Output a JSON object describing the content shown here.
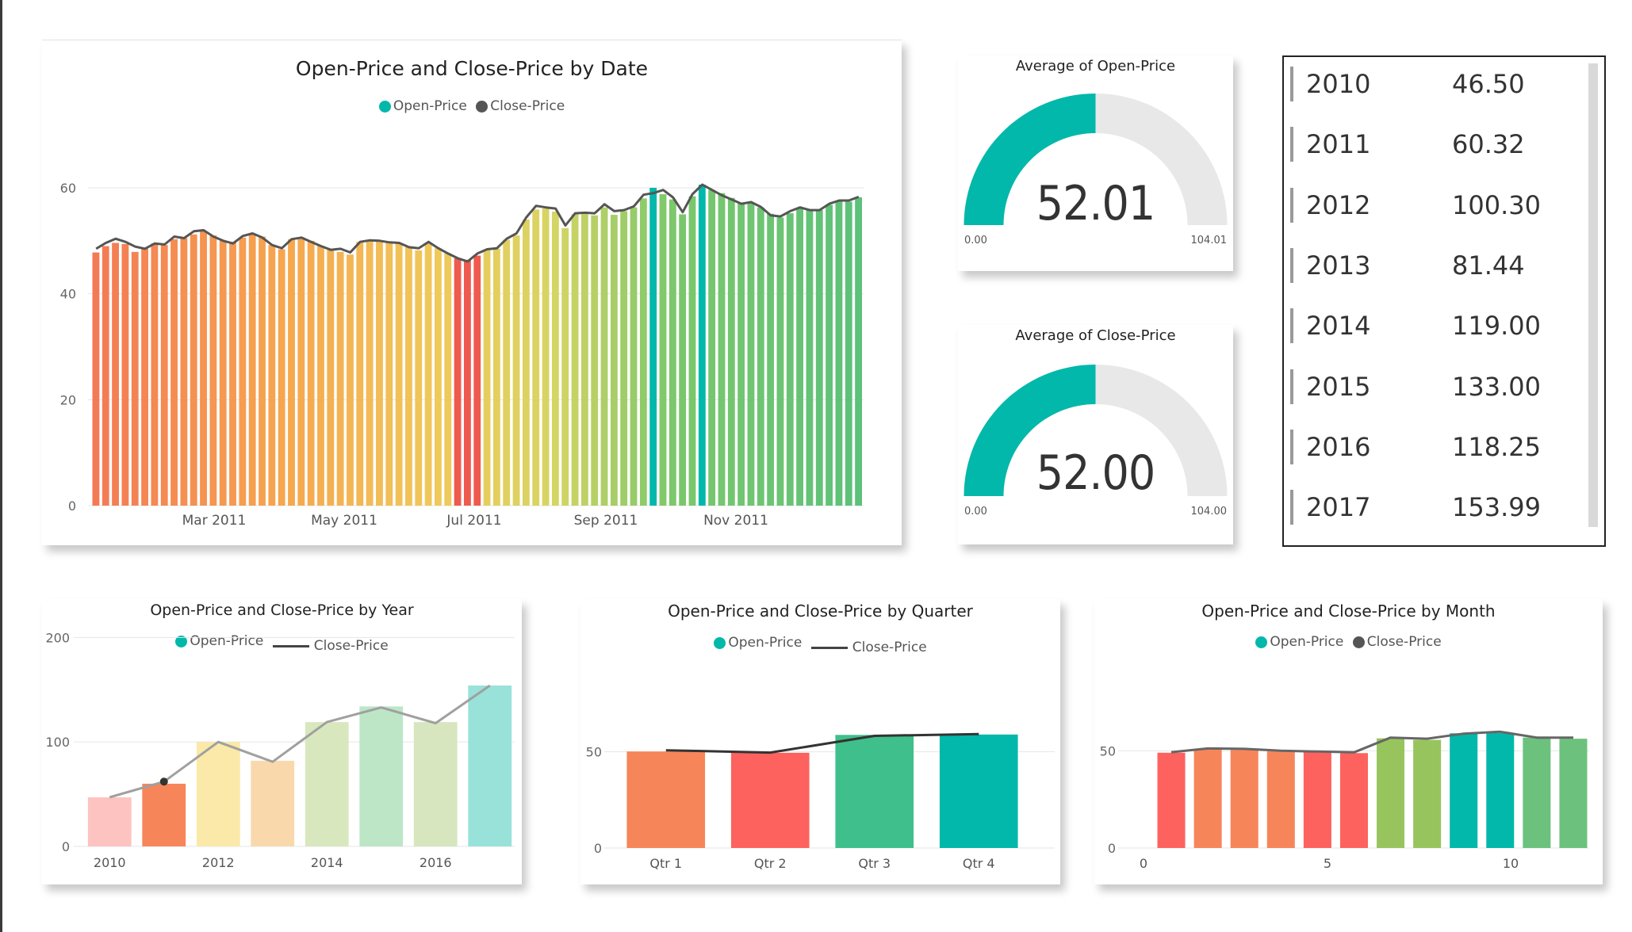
{
  "colors": {
    "open": "#01B8AA",
    "close": "#555555"
  },
  "chart_data": [
    {
      "type": "bar",
      "title": "Open-Price and Close-Price by Date",
      "legend": [
        "Open-Price",
        "Close-Price"
      ],
      "xticks": [
        "Mar 2011",
        "May 2011",
        "Jul 2011",
        "Sep 2011",
        "Nov 2011"
      ],
      "yticks": [
        "0",
        "20",
        "40",
        "60"
      ],
      "ylim": [
        0,
        70
      ],
      "grid": true,
      "open": [
        47.8,
        49.0,
        49.6,
        49.4,
        47.9,
        48.5,
        49.5,
        49.2,
        50.3,
        50.5,
        51.2,
        51.8,
        51.0,
        50.0,
        49.8,
        50.6,
        51.4,
        50.8,
        49.2,
        48.4,
        50.3,
        50.6,
        50.0,
        49.0,
        48.3,
        47.9,
        47.4,
        49.8,
        50.0,
        50.1,
        49.7,
        49.6,
        48.8,
        48.2,
        49.4,
        48.6,
        47.6,
        46.7,
        46.4,
        47.2,
        48.3,
        48.5,
        50.2,
        51.0,
        54.0,
        55.9,
        56.1,
        55.5,
        52.4,
        55.0,
        55.2,
        54.8,
        56.3,
        54.9,
        55.6,
        56.3,
        58.0,
        60.0,
        58.8,
        57.8,
        55.0,
        58.4,
        60.6,
        59.6,
        59.0,
        58.1,
        57.2,
        57.1,
        56.3,
        55.1,
        54.4,
        55.2,
        56.1,
        55.8,
        55.8,
        56.8,
        57.4,
        57.4,
        58.2
      ],
      "close": [
        48.5,
        49.6,
        50.4,
        49.8,
        48.9,
        48.5,
        49.5,
        49.3,
        50.8,
        50.5,
        51.8,
        52.0,
        50.8,
        50.0,
        49.5,
        50.9,
        51.4,
        50.6,
        49.2,
        48.6,
        50.3,
        50.6,
        49.8,
        49.0,
        48.3,
        48.5,
        47.8,
        49.8,
        50.1,
        50.0,
        49.7,
        49.6,
        48.8,
        48.6,
        49.8,
        48.6,
        47.6,
        46.7,
        46.1,
        47.6,
        48.4,
        48.6,
        50.4,
        51.4,
        54.4,
        56.6,
        56.3,
        56.1,
        52.9,
        55.2,
        55.3,
        55.2,
        56.9,
        55.6,
        55.8,
        56.5,
        58.7,
        59.0,
        59.6,
        58.2,
        55.4,
        58.8,
        60.6,
        59.6,
        58.6,
        57.8,
        57.0,
        57.3,
        56.4,
        54.8,
        54.6,
        55.6,
        56.3,
        55.8,
        55.8,
        57.0,
        57.6,
        57.6,
        58.3
      ]
    },
    {
      "type": "gauge",
      "title": "Average of Open-Price",
      "value": 52.01,
      "value_label": "52.01",
      "min_label": "0.00",
      "max_label": "104.01",
      "min": 0,
      "max": 104.01
    },
    {
      "type": "gauge",
      "title": "Average of Close-Price",
      "value": 52.0,
      "value_label": "52.00",
      "min_label": "0.00",
      "max_label": "104.00",
      "min": 0,
      "max": 104.0
    },
    {
      "type": "table",
      "rows": [
        {
          "year": "2010",
          "value": "46.50"
        },
        {
          "year": "2011",
          "value": "60.32"
        },
        {
          "year": "2012",
          "value": "100.30"
        },
        {
          "year": "2013",
          "value": "81.44"
        },
        {
          "year": "2014",
          "value": "119.00"
        },
        {
          "year": "2015",
          "value": "133.00"
        },
        {
          "year": "2016",
          "value": "118.25"
        },
        {
          "year": "2017",
          "value": "153.99"
        }
      ]
    },
    {
      "type": "bar",
      "title": "Open-Price and Close-Price by Year",
      "legend": [
        "Open-Price",
        "Close-Price"
      ],
      "categories": [
        "2010",
        "2011",
        "2012",
        "2013",
        "2014",
        "2015",
        "2016",
        "2017"
      ],
      "xticks": [
        "2010",
        "2012",
        "2014",
        "2016"
      ],
      "yticks": [
        "0",
        "100",
        "200"
      ],
      "ylim": [
        0,
        220
      ],
      "open": [
        47,
        60,
        100,
        82,
        119,
        134,
        119,
        154
      ],
      "close": [
        47,
        62,
        100,
        81,
        119,
        133,
        118,
        154
      ],
      "colors": [
        "#FDC3C0",
        "#F7855A",
        "#FAE9A9",
        "#F9D9AC",
        "#D9E7BE",
        "#BDE6C7",
        "#D7E6BE",
        "#98E2D9"
      ]
    },
    {
      "type": "bar",
      "title": "Open-Price and Close-Price by Quarter",
      "legend": [
        "Open-Price",
        "Close-Price"
      ],
      "categories": [
        "Qtr 1",
        "Qtr 2",
        "Qtr 3",
        "Qtr 4"
      ],
      "yticks": [
        "0",
        "50"
      ],
      "ylim": [
        0,
        75
      ],
      "open": [
        50.2,
        49.5,
        58.8,
        59.0
      ],
      "close": [
        50.8,
        49.6,
        58.3,
        59.2
      ],
      "colors": [
        "#F7855A",
        "#FD625E",
        "#3FBF8B",
        "#01B8AA"
      ]
    },
    {
      "type": "bar",
      "title": "Open-Price and Close-Price by Month",
      "legend": [
        "Open-Price",
        "Close-Price"
      ],
      "categories": [
        "1",
        "2",
        "3",
        "4",
        "5",
        "6",
        "7",
        "8",
        "9",
        "10",
        "11",
        "12"
      ],
      "xticks": [
        "0",
        "5",
        "10"
      ],
      "yticks": [
        "0",
        "50"
      ],
      "ylim": [
        0,
        75
      ],
      "open": [
        49.0,
        50.9,
        50.5,
        49.7,
        49.6,
        48.8,
        56.4,
        55.6,
        59.0,
        59.2,
        56.8,
        56.2
      ],
      "close": [
        49.3,
        51.2,
        51.0,
        50.0,
        49.6,
        49.2,
        56.8,
        56.2,
        58.8,
        59.8,
        56.8,
        56.8
      ],
      "colors": [
        "#FD625E",
        "#F7855A",
        "#F7855A",
        "#F7855A",
        "#FD625E",
        "#FD625E",
        "#98C45E",
        "#98C45E",
        "#01B8AA",
        "#01B8AA",
        "#6CC27C",
        "#6CC27C"
      ]
    }
  ]
}
